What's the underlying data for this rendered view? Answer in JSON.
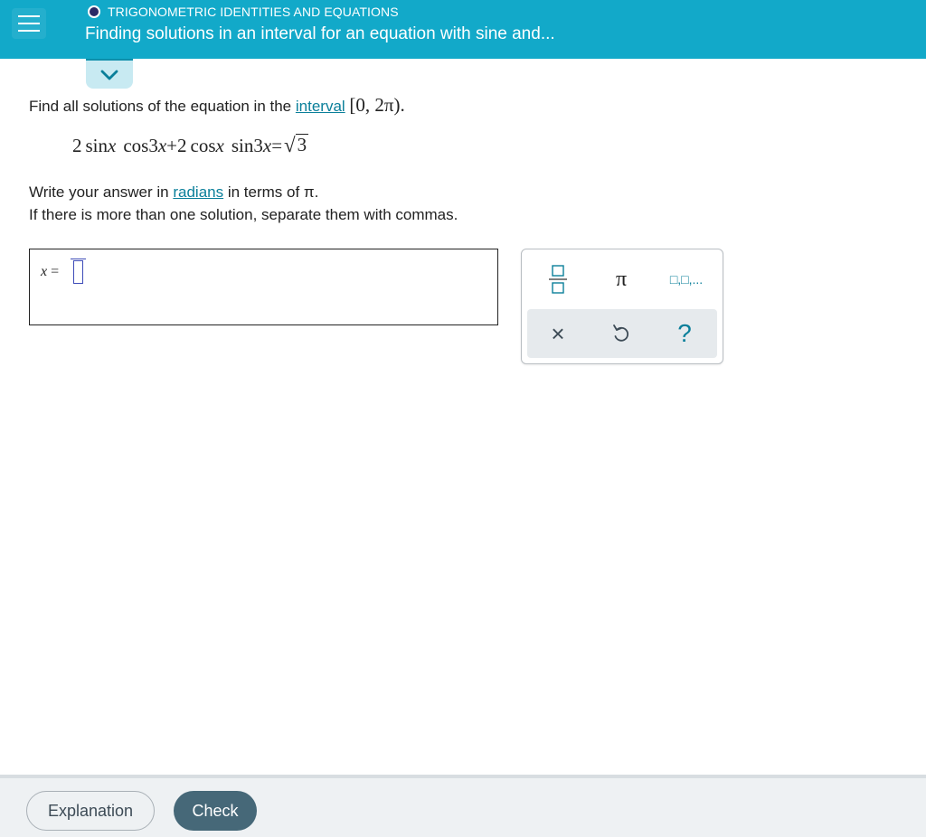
{
  "header": {
    "topic": "TRIGONOMETRIC IDENTITIES AND EQUATIONS",
    "title": "Finding solutions in an interval for an equation with sine and..."
  },
  "problem": {
    "prompt_before": "Find all solutions of the equation in the ",
    "interval_link": "interval",
    "interval_text": "[0, 2π).",
    "equation": {
      "coef1": "2",
      "t1": "sin",
      "v1": "x",
      "t2": "cos",
      "n2": "3",
      "v2": "x",
      "plus": "+",
      "coef2": "2",
      "t3": "cos",
      "v3": "x",
      "t4": "sin",
      "n4": "3",
      "v4": "x",
      "equals": "=",
      "radicand": "3"
    },
    "instr_before": "Write your answer in ",
    "radians_link": "radians",
    "instr_after": " in terms of π.",
    "instr2": "If there is more than one solution, separate them with commas."
  },
  "answer": {
    "variable": "x",
    "equals": "="
  },
  "keypad": {
    "pi_label": "π",
    "list_label": "□,□,...",
    "clear_label": "×",
    "help_label": "?"
  },
  "footer": {
    "explanation_label": "Explanation",
    "check_label": "Check"
  },
  "colors": {
    "header_bg": "#12a9c9",
    "link": "#0a7f9a",
    "check_bg": "#466878"
  }
}
